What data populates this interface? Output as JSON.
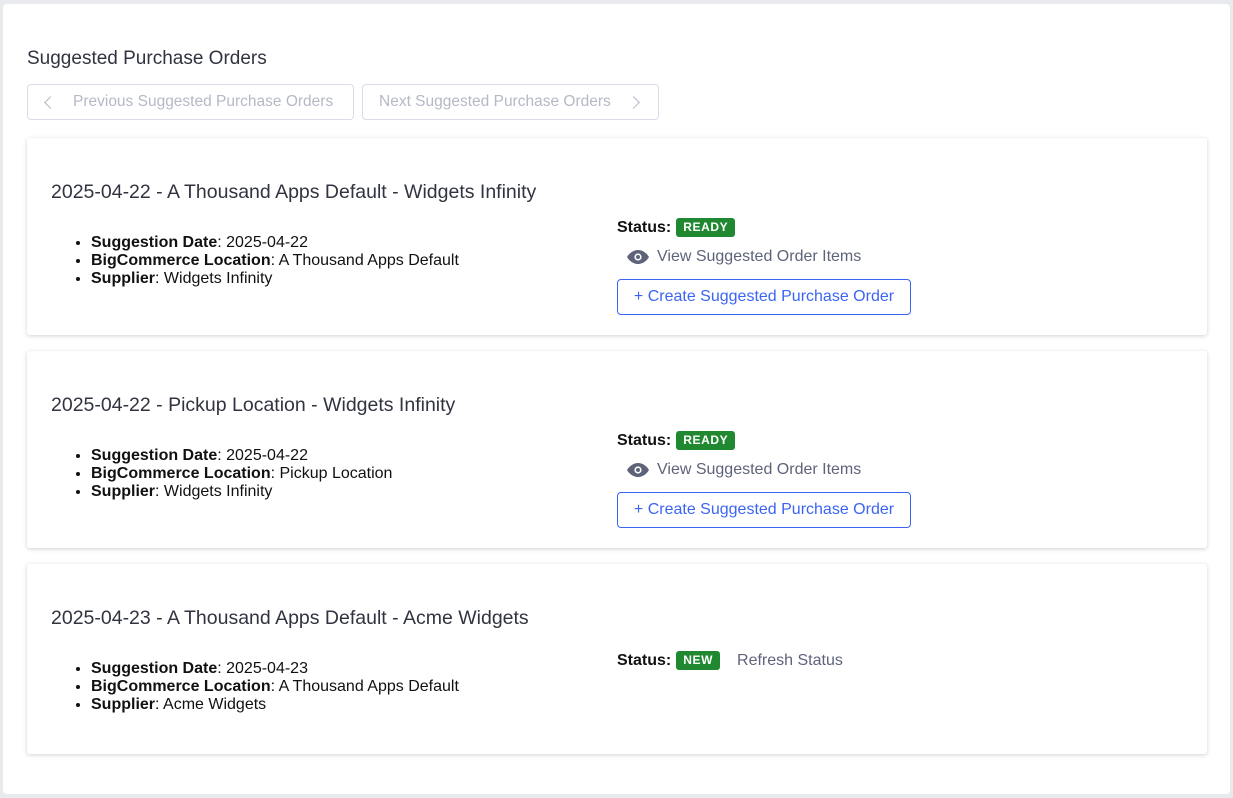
{
  "page": {
    "title": "Suggested Purchase Orders",
    "prev_label": "Previous Suggested Purchase Orders",
    "next_label": "Next Suggested Purchase Orders"
  },
  "labels": {
    "status": "Status",
    "suggestion_date": "Suggestion Date",
    "location": "BigCommerce Location",
    "supplier": "Supplier",
    "view_items": "View Suggested Order Items",
    "create_order": "+ Create Suggested Purchase Order",
    "refresh_status": "Refresh Status"
  },
  "colors": {
    "accent": "#3c64f4",
    "badge_green": "#208831",
    "muted": "#5e637a",
    "disabled": "#b5b9c6"
  },
  "orders": [
    {
      "title": "2025-04-22 - A Thousand Apps Default - Widgets Infinity",
      "suggestion_date": "2025-04-22",
      "location": "A Thousand Apps Default",
      "supplier": "Widgets Infinity",
      "status": "READY"
    },
    {
      "title": "2025-04-22 - Pickup Location - Widgets Infinity",
      "suggestion_date": "2025-04-22",
      "location": "Pickup Location",
      "supplier": "Widgets Infinity",
      "status": "READY"
    },
    {
      "title": "2025-04-23 - A Thousand Apps Default - Acme Widgets",
      "suggestion_date": "2025-04-23",
      "location": "A Thousand Apps Default",
      "supplier": "Acme Widgets",
      "status": "NEW"
    }
  ]
}
